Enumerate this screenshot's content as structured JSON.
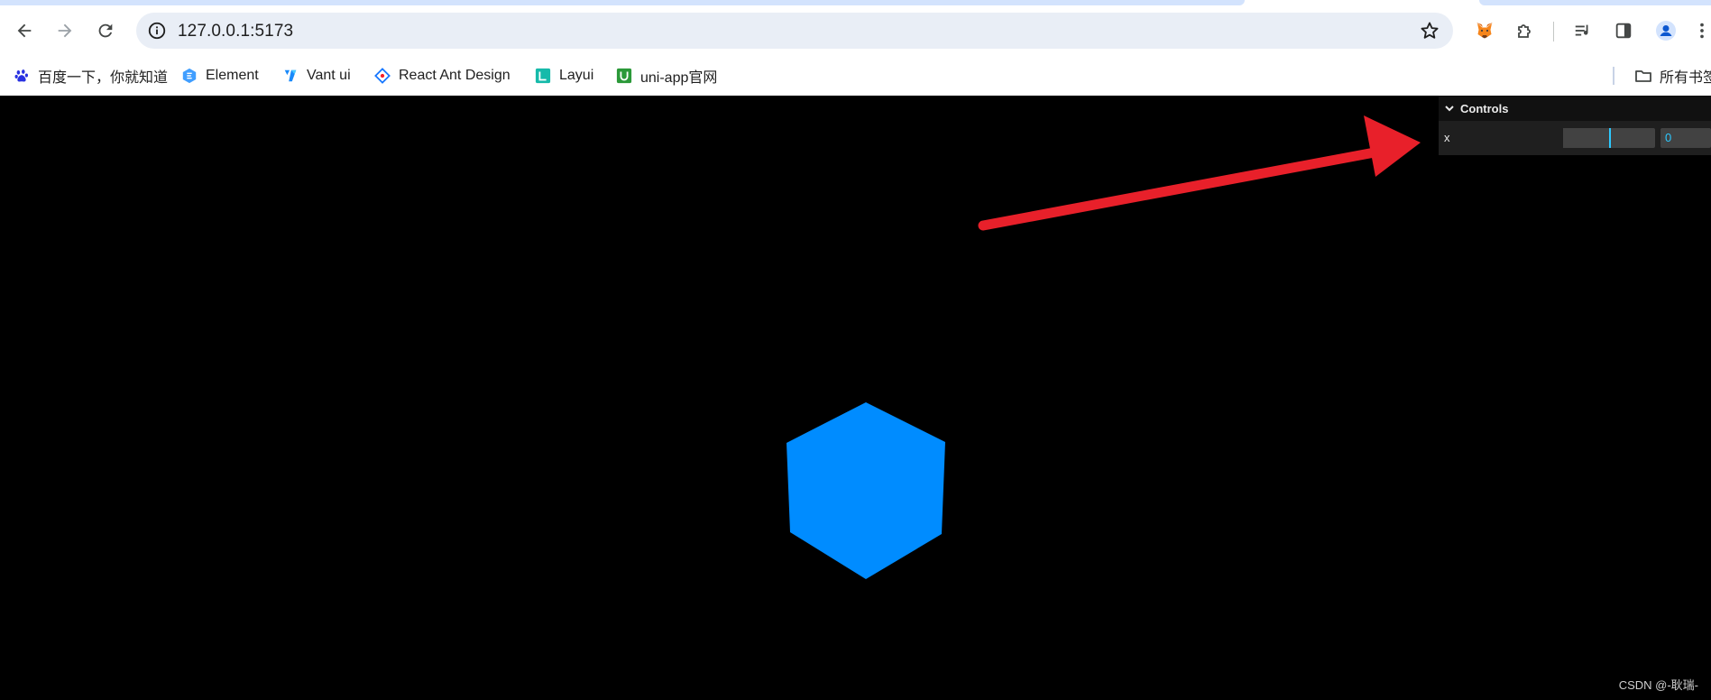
{
  "browser": {
    "url": "127.0.0.1:5173",
    "bookmarks": [
      {
        "label": "百度一下，你就知道",
        "icon": "baidu-paw-icon"
      },
      {
        "label": "Element",
        "icon": "element-logo-icon"
      },
      {
        "label": "Vant ui",
        "icon": "vant-logo-icon"
      },
      {
        "label": "React Ant Design",
        "icon": "antd-logo-icon"
      },
      {
        "label": "Layui",
        "icon": "layui-logo-icon"
      },
      {
        "label": "uni-app官网",
        "icon": "uniapp-logo-icon"
      }
    ],
    "all_bookmarks_label": "所有书签"
  },
  "gui": {
    "title": "Controls",
    "controls": [
      {
        "label": "x",
        "value": "0",
        "fraction": 0.5
      }
    ]
  },
  "scene": {
    "cube_color": "#008cff",
    "background": "#000000",
    "annotation_arrow_color": "#e8202a"
  },
  "watermark": "CSDN @-耿瑞-"
}
